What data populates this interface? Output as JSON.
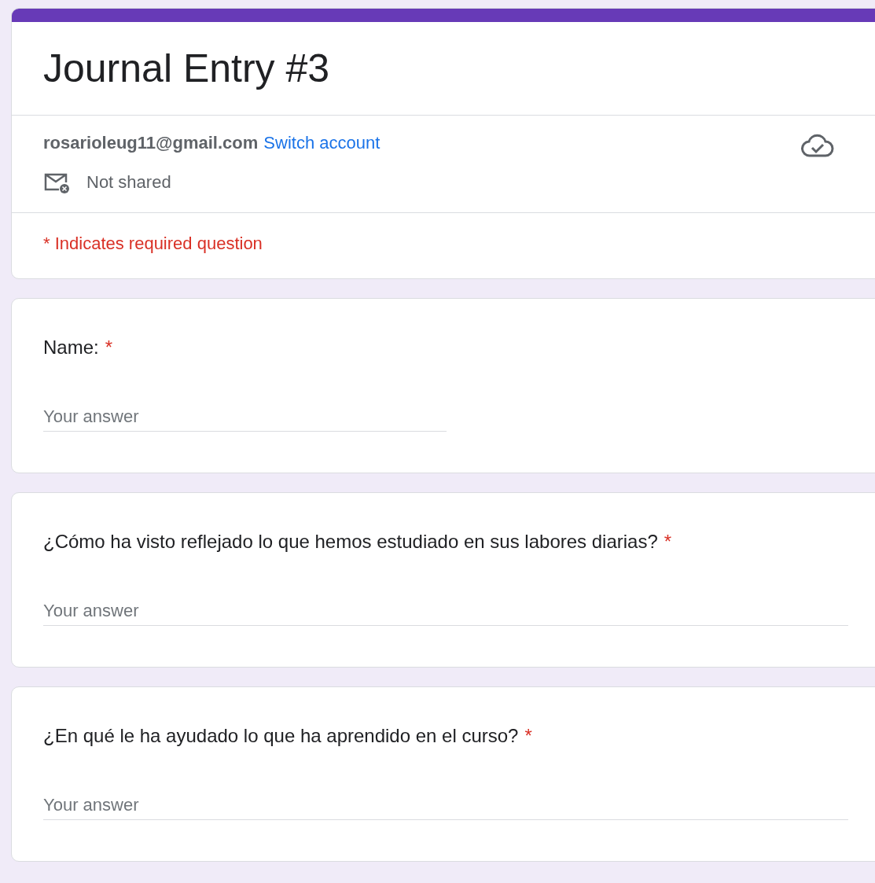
{
  "form": {
    "title": "Journal Entry #3",
    "account": {
      "email": "rosarioleug11@gmail.com",
      "switch_link": "Switch account",
      "sharing": "Not shared",
      "saved": true
    },
    "required_note": "* Indicates required question"
  },
  "questions": [
    {
      "kind": "short_answer",
      "label": "Name:",
      "required": true,
      "required_mark": "*",
      "placeholder": "Your answer"
    },
    {
      "kind": "paragraph",
      "label": "¿Cómo ha visto reflejado lo que hemos estudiado en sus labores diarias?",
      "required": true,
      "required_mark": "*",
      "placeholder": "Your answer"
    },
    {
      "kind": "paragraph",
      "label": "¿En qué le ha ayudado lo que ha aprendido en el curso?",
      "required": true,
      "required_mark": "*",
      "placeholder": "Your answer"
    }
  ]
}
